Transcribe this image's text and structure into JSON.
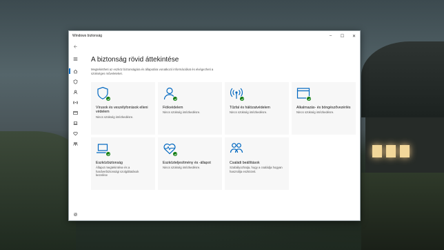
{
  "window": {
    "title": "Windows biztonság",
    "minimize": "–",
    "maximize": "☐",
    "close": "✕"
  },
  "sidebar": {
    "items": [
      {
        "icon": "back-arrow-icon"
      },
      {
        "icon": "hamburger-menu-icon"
      },
      {
        "icon": "home-icon",
        "active": true
      },
      {
        "icon": "shield-icon"
      },
      {
        "icon": "person-icon"
      },
      {
        "icon": "wifi-signal-icon"
      },
      {
        "icon": "app-browser-icon"
      },
      {
        "icon": "device-icon"
      },
      {
        "icon": "heart-icon"
      },
      {
        "icon": "family-icon"
      },
      {
        "icon": "settings-gear-icon"
      }
    ]
  },
  "main": {
    "title": "A biztonság rövid áttekintése",
    "description": "Megtekintheti az eszköz biztonságára és állapotára vonatkozó információkat és elvégezheti a szükséges műveleteket."
  },
  "cards": [
    {
      "icon": "shield-icon",
      "title": "Vírusok és veszélyforrások elleni védelem",
      "status": "Nincs szükség intézkedésre."
    },
    {
      "icon": "person-icon",
      "title": "Fiókvédelem",
      "status": "Nincs szükség intézkedésre."
    },
    {
      "icon": "wifi-signal-icon",
      "title": "Tűzfal és hálózatvédelem",
      "status": "Nincs szükség intézkedésre."
    },
    {
      "icon": "app-browser-icon",
      "title": "Alkalmazás- és böngészővezérlés",
      "status": "Nincs szükség intézkedésre."
    },
    {
      "icon": "laptop-icon",
      "title": "Eszközbiztonság",
      "status": "Állapot megtekintése és a hardverbiztonsági szolgáltatások kezelése"
    },
    {
      "icon": "heart-pulse-icon",
      "title": "Eszközteljesítmény és -állapot",
      "status": "Nincs szükség intézkedésre."
    },
    {
      "icon": "family-icon",
      "title": "Családi beállítások",
      "status": "Szabályozhatja, hogy a családja hogyan használja eszközeit."
    }
  ],
  "colors": {
    "accent": "#0067c0",
    "check": "#107c10"
  }
}
